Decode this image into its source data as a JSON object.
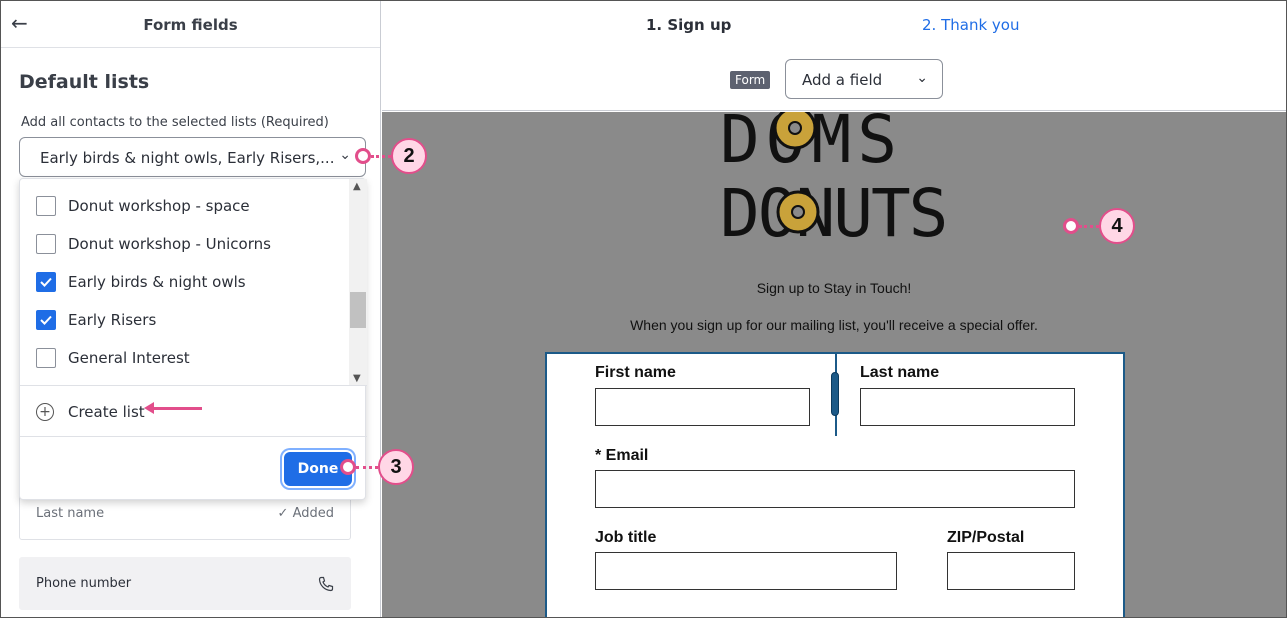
{
  "topbar": {
    "back_icon": "arrow-left-icon",
    "title": "Form fields"
  },
  "section": {
    "title": "Default lists",
    "help_text": "Add all contacts to the selected lists (Required)",
    "select_value": "Early birds & night owls, Early Risers,...",
    "options": [
      {
        "label": "Donut workshop - space",
        "checked": false
      },
      {
        "label": "Donut workshop - Unicorns",
        "checked": false
      },
      {
        "label": "Early birds & night owls",
        "checked": true
      },
      {
        "label": "Early Risers",
        "checked": true
      },
      {
        "label": "General Interest",
        "checked": false
      }
    ],
    "create_label": "Create list",
    "done_label": "Done"
  },
  "fields": [
    {
      "label": "Last name",
      "status": "✓ Added"
    },
    {
      "label": "Phone number",
      "icon": "phone-icon"
    }
  ],
  "steps": {
    "step1": "1.  Sign up",
    "step2": "2.  Thank you"
  },
  "toolbar": {
    "form_tag": "Form",
    "add_field": "Add a field"
  },
  "preview": {
    "logo_line1": "DOMS",
    "logo_line2": "DONUTS",
    "tagline": "Sign up to Stay in Touch!",
    "subtext": "When you sign up for our mailing list, you'll receive a special offer.",
    "form": {
      "first_name": "First name",
      "last_name": "Last name",
      "email": "* Email",
      "job_title": "Job title",
      "zip": "ZIP/Postal"
    }
  },
  "callouts": {
    "c2": "2",
    "c3": "3",
    "c4": "4"
  },
  "colors": {
    "accent": "#1f6de6",
    "callout": "#e24e8b",
    "callout_fill": "#ffd7e6",
    "form_border": "#1c5a88",
    "canvas": "#8a8a8a"
  }
}
